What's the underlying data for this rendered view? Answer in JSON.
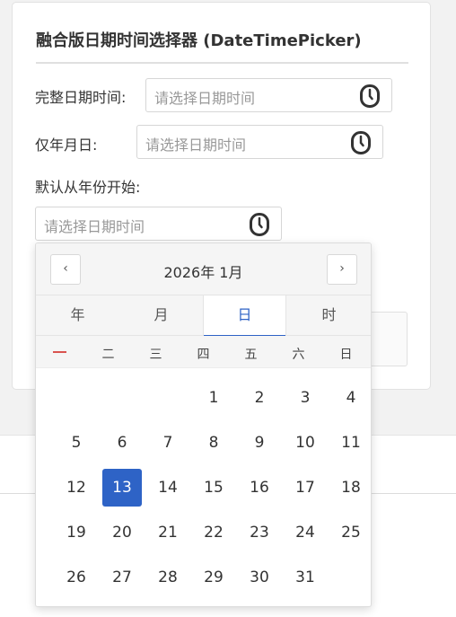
{
  "card": {
    "title": "融合版日期时间选择器 (DateTimePicker)"
  },
  "fields": [
    {
      "label": "完整日期时间:",
      "placeholder": "请选择日期时间",
      "icon": "clock-icon"
    },
    {
      "label": "仅年月日:",
      "placeholder": "请选择日期时间",
      "icon": "clock-icon"
    },
    {
      "label": "默认从年份开始:",
      "placeholder": "请选择日期时间",
      "icon": "clock-icon"
    }
  ],
  "picker": {
    "prev_label": "‹",
    "next_label": "›",
    "title": "2026年 1月",
    "tabs": [
      "年",
      "月",
      "日",
      "时"
    ],
    "active_tab": "日",
    "weekdays": [
      "一",
      "二",
      "三",
      "四",
      "五",
      "六",
      "日"
    ],
    "weekday_first_color": "#d9534f",
    "days": [
      [
        "",
        "",
        "",
        "1",
        "2",
        "3",
        "4"
      ],
      [
        "5",
        "6",
        "7",
        "8",
        "9",
        "10",
        "11"
      ],
      [
        "12",
        "13",
        "14",
        "15",
        "16",
        "17",
        "18"
      ],
      [
        "19",
        "20",
        "21",
        "22",
        "23",
        "24",
        "25"
      ],
      [
        "26",
        "27",
        "28",
        "29",
        "30",
        "31",
        ""
      ]
    ],
    "selected_day": "13",
    "accent_color": "#2e63c6"
  }
}
